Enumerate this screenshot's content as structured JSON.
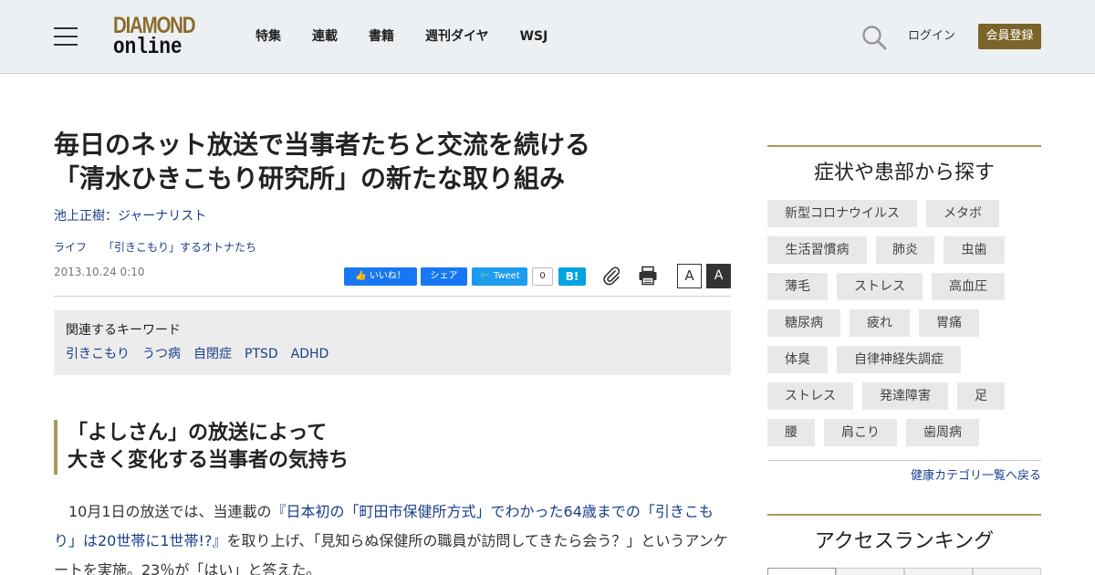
{
  "header": {
    "logo_top": "DIAMOND",
    "logo_bottom": "online",
    "nav": [
      "特集",
      "連載",
      "書籍",
      "週刊ダイヤ",
      "WSJ"
    ],
    "login": "ログイン",
    "register": "会員登録"
  },
  "article": {
    "title_line1": "毎日のネット放送で当事者たちと交流を続ける",
    "title_line2": "「清水ひきこもり研究所」の新たな取り組み",
    "author": "池上正樹：ジャーナリスト",
    "categories": [
      "ライフ",
      "「引きこもり」するオトナたち"
    ],
    "date": "2013.10.24 0:10",
    "share": {
      "like": "いいね！",
      "fb_share": "シェア",
      "tweet": "Tweet",
      "tweet_count": "0",
      "hatena": "B!"
    },
    "font_size": {
      "small": "A",
      "large": "A"
    },
    "keywords_title": "関連するキーワード",
    "keywords": [
      "引きこもり",
      "うつ病",
      "自閉症",
      "PTSD",
      "ADHD"
    ],
    "subhead_line1": "「よしさん」の放送によって",
    "subhead_line2": "大きく変化する当事者の気持ち",
    "body": {
      "p1_prefix": "　10月1日の放送では、当連載の",
      "p1_link": "『日本初の「町田市保健所方式」でわかった64歳までの「引きこもり」は20世帯に1世帯!?』",
      "p1_suffix": "を取り上げ、「見知らぬ保健所の職員が訪問してきたら会う？」というアンケートを実施。23％が「はい」と答えた。"
    }
  },
  "sidebar": {
    "symptoms_title": "症状や患部から探す",
    "symptoms": [
      [
        "新型コロナウイルス",
        "メタボ"
      ],
      [
        "生活習慣病",
        "肺炎",
        "虫歯"
      ],
      [
        "薄毛",
        "ストレス",
        "高血圧"
      ],
      [
        "糖尿病",
        "疲れ",
        "胃痛"
      ],
      [
        "体臭",
        "自律神経失調症"
      ],
      [
        "ストレス",
        "発達障害",
        "足"
      ],
      [
        "腰",
        "肩こり",
        "歯周病"
      ]
    ],
    "category_link": "健康カテゴリ一覧へ戻る",
    "ranking_title": "アクセスランキング"
  },
  "colors": {
    "header_bg": "#edf0f3",
    "brand_gold": "#8a6d2c",
    "register_bg": "#7a6429",
    "link": "#1a3e8c",
    "accent_rule": "#a89a5b"
  },
  "icons": [
    "menu-icon",
    "search-icon",
    "paperclip-icon",
    "printer-icon",
    "facebook-icon",
    "twitter-icon"
  ]
}
